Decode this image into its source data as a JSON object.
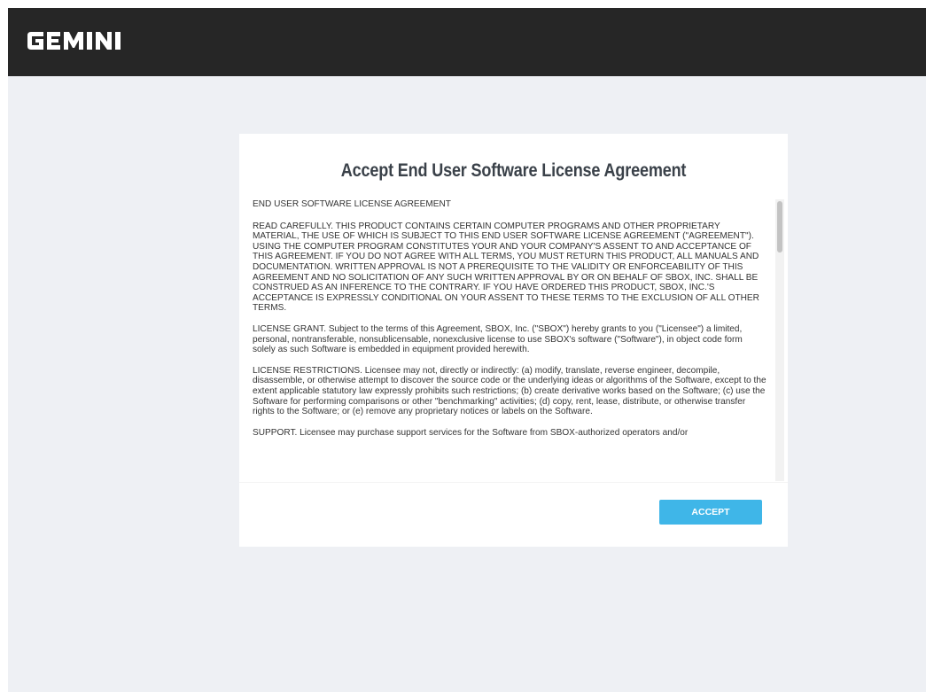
{
  "brand": {
    "logo_text": "GEMINI"
  },
  "dialog": {
    "title": "Accept End User Software License Agreement",
    "paragraphs": [
      "END USER SOFTWARE LICENSE AGREEMENT",
      "READ CAREFULLY. THIS PRODUCT CONTAINS CERTAIN COMPUTER PROGRAMS AND OTHER PROPRIETARY MATERIAL, THE USE OF WHICH IS SUBJECT TO THIS END USER SOFTWARE LICENSE AGREEMENT (\"AGREEMENT\"). USING THE COMPUTER PROGRAM CONSTITUTES YOUR AND YOUR COMPANY'S ASSENT TO AND ACCEPTANCE OF THIS AGREEMENT. IF YOU DO NOT AGREE WITH ALL TERMS, YOU MUST RETURN THIS PRODUCT, ALL MANUALS AND DOCUMENTATION. WRITTEN APPROVAL IS NOT A PREREQUISITE TO THE VALIDITY OR ENFORCEABILITY OF THIS AGREEMENT AND NO SOLICITATION OF ANY SUCH WRITTEN APPROVAL BY OR ON BEHALF OF SBOX, INC. SHALL BE CONSTRUED AS AN INFERENCE TO THE CONTRARY. IF YOU HAVE ORDERED THIS PRODUCT, SBOX, INC.'S ACCEPTANCE IS EXPRESSLY CONDITIONAL ON YOUR ASSENT TO THESE TERMS TO THE EXCLUSION OF ALL OTHER TERMS.",
      "LICENSE GRANT. Subject to the terms of this Agreement, SBOX, Inc. (\"SBOX\") hereby grants to you (\"Licensee\") a limited, personal, nontransferable, nonsublicensable, nonexclusive license to use SBOX's software (\"Software\"), in object code form solely as such Software is embedded in equipment provided herewith.",
      "LICENSE RESTRICTIONS. Licensee may not, directly or indirectly: (a) modify, translate, reverse engineer, decompile, disassemble, or otherwise attempt to discover the source code or the underlying ideas or algorithms of the Software, except to the extent applicable statutory law expressly prohibits such restrictions; (b) create derivative works based on the Software; (c) use the Software for performing comparisons or other \"benchmarking\" activities; (d) copy, rent, lease, distribute, or otherwise transfer rights to the Software; or (e) remove any proprietary notices or labels on the Software.",
      "SUPPORT. Licensee may purchase support services for the Software from SBOX-authorized operators and/or"
    ],
    "accept_label": "ACCEPT"
  }
}
